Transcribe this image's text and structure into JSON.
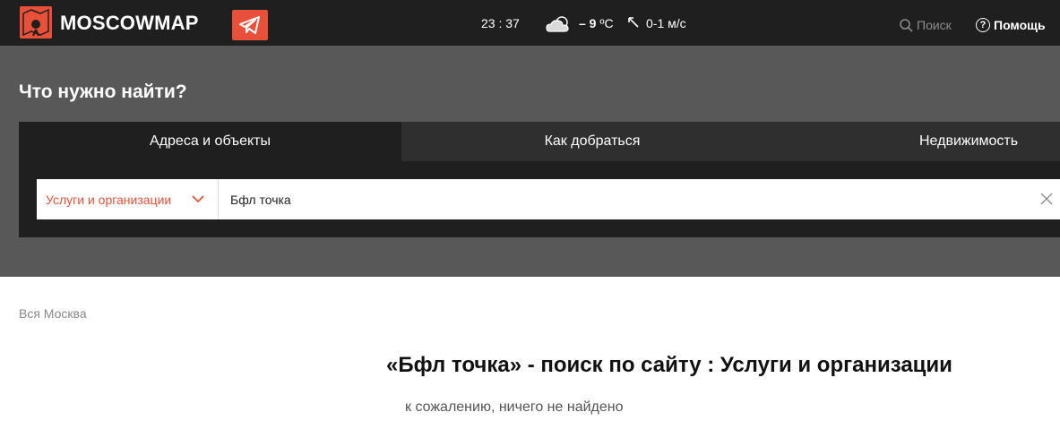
{
  "header": {
    "brand": "MOSCOWMAP",
    "time": "23 : 37",
    "temperature_value": "– 9",
    "temperature_unit": " ºC",
    "wind": "0-1 м/с",
    "search_label": "Поиск",
    "help_label": "Помощь",
    "icons": [
      "map-pin-logo-icon",
      "telegram-icon",
      "cloud-icon",
      "wind-direction-icon",
      "search-icon",
      "help-icon"
    ],
    "accent_color": "#e8503a"
  },
  "search_band": {
    "title": "Что нужно найти?",
    "tabs": [
      {
        "label": "Адреса и объекты"
      },
      {
        "label": "Как добраться"
      },
      {
        "label": "Недвижимость"
      }
    ],
    "category_selected": "Услуги и организации",
    "query_value": "Бфл точка"
  },
  "main": {
    "breadcrumb": "Вся Москва",
    "result_title": "«Бфл точка» - поиск по сайту : Услуги и организации",
    "no_results": "к сожалению, ничего не найдено"
  }
}
